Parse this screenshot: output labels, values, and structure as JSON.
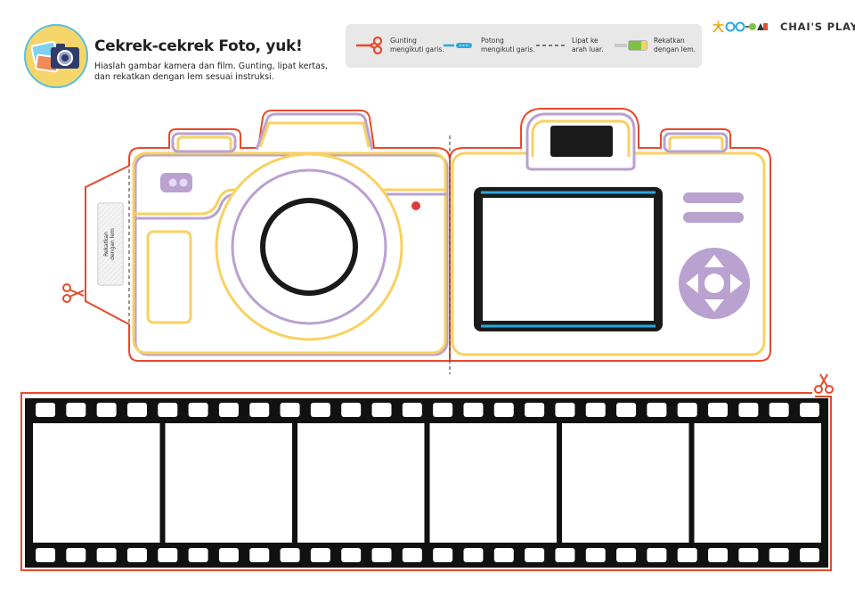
{
  "header": {
    "title": "Cekrek-cekrek Foto, yuk!",
    "subtitle_line1": "Hiaslah gambar kamera dan film. Gunting, lipat kertas,",
    "subtitle_line2": "dan rekatkan dengan lem sesuai instruksi."
  },
  "legend": {
    "items": [
      {
        "icon": "scissors-icon",
        "line1": "Gunting",
        "line2": "mengikuti garis."
      },
      {
        "icon": "cutter-knife-icon",
        "line1": "Potong",
        "line2": "mengikuti garis."
      },
      {
        "icon": "dashed-line-icon",
        "line1": "Lipat ke",
        "line2": "arah luar."
      },
      {
        "icon": "glue-stick-icon",
        "line1": "Rekatkan",
        "line2": "dengan lem."
      }
    ]
  },
  "brand": {
    "name": "CHAI'S PLAY",
    "logo": "zoo-m-logo"
  },
  "camera": {
    "glue_tab_line1": "Rekatkan",
    "glue_tab_line2": "dengan lem"
  },
  "film": {
    "frames": 6,
    "sprocket_holes_per_row": 26
  },
  "colors": {
    "cut_line": "#e8492a",
    "camera_outline": "#f8d160",
    "camera_accent": "#b9a1d0",
    "screen_line": "#29a8df",
    "shutter_dot": "#e23b3b",
    "glue_green": "#7cc242",
    "film_black": "#111111"
  }
}
